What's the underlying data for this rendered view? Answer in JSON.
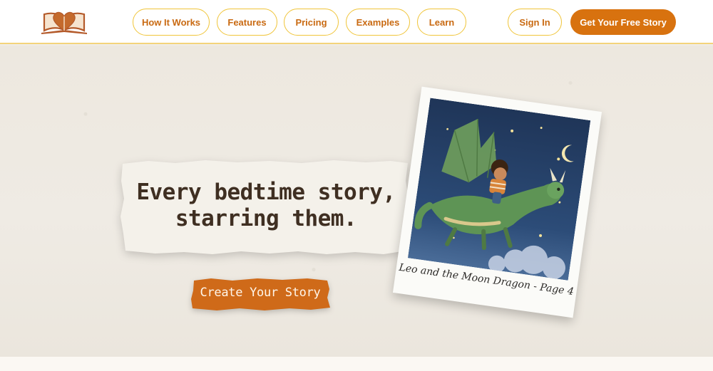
{
  "nav": {
    "items": [
      {
        "label": "How It Works"
      },
      {
        "label": "Features"
      },
      {
        "label": "Pricing"
      },
      {
        "label": "Examples"
      },
      {
        "label": "Learn"
      }
    ],
    "sign_in": "Sign In",
    "cta": "Get Your Free Story"
  },
  "hero": {
    "headline_line1": "Every bedtime story,",
    "headline_line2": "starring them.",
    "button_label": "Create Your Story",
    "polaroid_caption": "Leo and the Moon Dragon - Page 4"
  },
  "colors": {
    "accent": "#d8720f",
    "nav_border": "#f0c53a",
    "nav_text": "#c96a12",
    "headline_text": "#3f2f22",
    "hero_bg": "#f1ede6"
  },
  "icons": {
    "logo": "open-book-heart-icon"
  }
}
